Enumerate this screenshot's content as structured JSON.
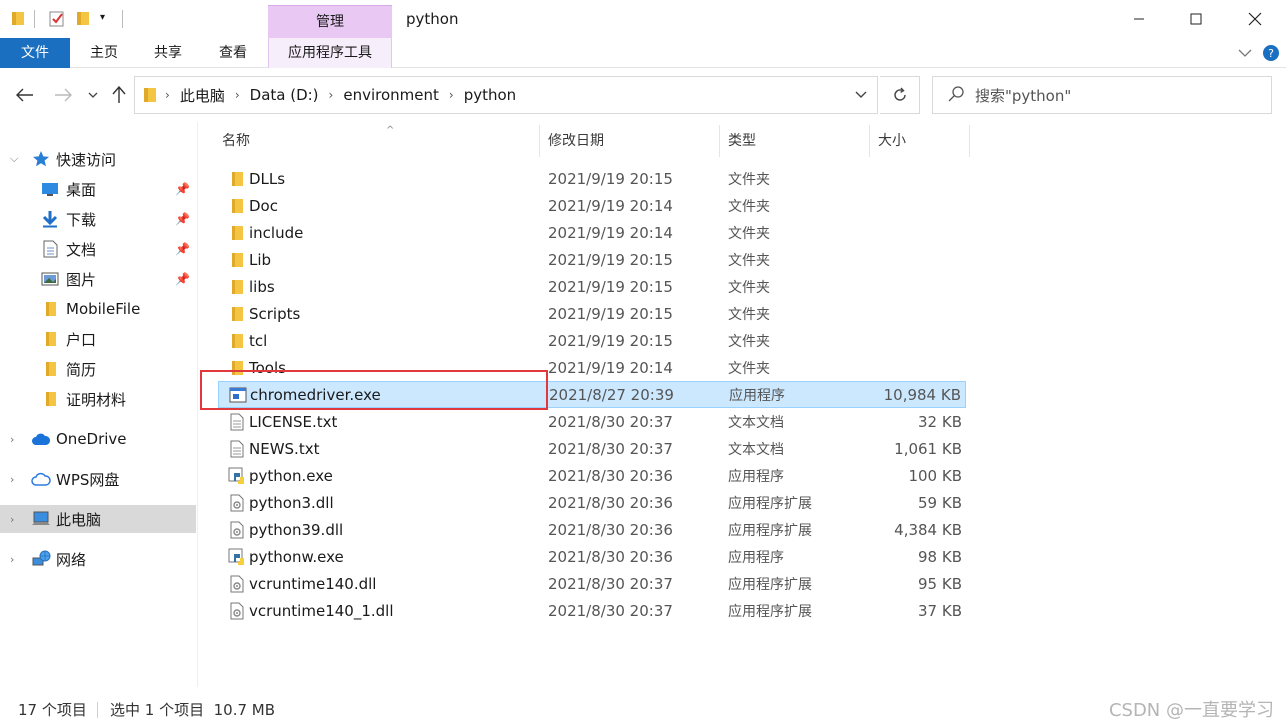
{
  "window": {
    "title": "python",
    "context_tab": "管理"
  },
  "ribbon": {
    "tabs": [
      "文件",
      "主页",
      "共享",
      "查看",
      "应用程序工具"
    ]
  },
  "address": {
    "breadcrumbs": [
      "此电脑",
      "Data (D:)",
      "environment",
      "python"
    ],
    "search_placeholder": "搜索\"python\""
  },
  "nav": {
    "items": [
      {
        "label": "快速访问",
        "icon": "star-icon",
        "pinned": false
      },
      {
        "label": "桌面",
        "icon": "desktop-icon",
        "pinned": true
      },
      {
        "label": "下载",
        "icon": "download-icon",
        "pinned": true
      },
      {
        "label": "文档",
        "icon": "document-icon",
        "pinned": true
      },
      {
        "label": "图片",
        "icon": "picture-icon",
        "pinned": true
      },
      {
        "label": "MobileFile",
        "icon": "folder-icon",
        "pinned": false
      },
      {
        "label": "户口",
        "icon": "folder-icon",
        "pinned": false
      },
      {
        "label": "简历",
        "icon": "folder-icon",
        "pinned": false
      },
      {
        "label": "证明材料",
        "icon": "folder-icon",
        "pinned": false
      },
      {
        "label": "OneDrive",
        "icon": "cloud-icon",
        "pinned": false
      },
      {
        "label": "WPS网盘",
        "icon": "cloud-outline-icon",
        "pinned": false
      },
      {
        "label": "此电脑",
        "icon": "computer-icon",
        "pinned": false
      },
      {
        "label": "网络",
        "icon": "network-icon",
        "pinned": false
      }
    ]
  },
  "columns": {
    "name": "名称",
    "date": "修改日期",
    "type": "类型",
    "size": "大小"
  },
  "files": [
    {
      "name": "DLLs",
      "date": "2021/9/19 20:15",
      "type": "文件夹",
      "size": "",
      "icon": "folder-icon"
    },
    {
      "name": "Doc",
      "date": "2021/9/19 20:14",
      "type": "文件夹",
      "size": "",
      "icon": "folder-icon"
    },
    {
      "name": "include",
      "date": "2021/9/19 20:14",
      "type": "文件夹",
      "size": "",
      "icon": "folder-icon"
    },
    {
      "name": "Lib",
      "date": "2021/9/19 20:15",
      "type": "文件夹",
      "size": "",
      "icon": "folder-icon"
    },
    {
      "name": "libs",
      "date": "2021/9/19 20:15",
      "type": "文件夹",
      "size": "",
      "icon": "folder-icon"
    },
    {
      "name": "Scripts",
      "date": "2021/9/19 20:15",
      "type": "文件夹",
      "size": "",
      "icon": "folder-icon"
    },
    {
      "name": "tcl",
      "date": "2021/9/19 20:15",
      "type": "文件夹",
      "size": "",
      "icon": "folder-icon"
    },
    {
      "name": "Tools",
      "date": "2021/9/19 20:14",
      "type": "文件夹",
      "size": "",
      "icon": "folder-icon"
    },
    {
      "name": "chromedriver.exe",
      "date": "2021/8/27 20:39",
      "type": "应用程序",
      "size": "10,984 KB",
      "icon": "app-icon"
    },
    {
      "name": "LICENSE.txt",
      "date": "2021/8/30 20:37",
      "type": "文本文档",
      "size": "32 KB",
      "icon": "text-file-icon"
    },
    {
      "name": "NEWS.txt",
      "date": "2021/8/30 20:37",
      "type": "文本文档",
      "size": "1,061 KB",
      "icon": "text-file-icon"
    },
    {
      "name": "python.exe",
      "date": "2021/8/30 20:36",
      "type": "应用程序",
      "size": "100 KB",
      "icon": "python-icon"
    },
    {
      "name": "python3.dll",
      "date": "2021/8/30 20:36",
      "type": "应用程序扩展",
      "size": "59 KB",
      "icon": "dll-file-icon"
    },
    {
      "name": "python39.dll",
      "date": "2021/8/30 20:36",
      "type": "应用程序扩展",
      "size": "4,384 KB",
      "icon": "dll-file-icon"
    },
    {
      "name": "pythonw.exe",
      "date": "2021/8/30 20:36",
      "type": "应用程序",
      "size": "98 KB",
      "icon": "python-icon"
    },
    {
      "name": "vcruntime140.dll",
      "date": "2021/8/30 20:37",
      "type": "应用程序扩展",
      "size": "95 KB",
      "icon": "dll-file-icon"
    },
    {
      "name": "vcruntime140_1.dll",
      "date": "2021/8/30 20:37",
      "type": "应用程序扩展",
      "size": "37 KB",
      "icon": "dll-file-icon"
    }
  ],
  "status": {
    "item_count": "17 个项目",
    "selection": "选中 1 个项目  10.7 MB",
    "watermark": "CSDN @一直要学习"
  },
  "colors": {
    "file_tab": "#1b6fc0",
    "context_tab": "#e9c8f3",
    "selected_row": "#cce8ff",
    "highlight_box": "#e0383b",
    "folder": "#f4c542"
  }
}
